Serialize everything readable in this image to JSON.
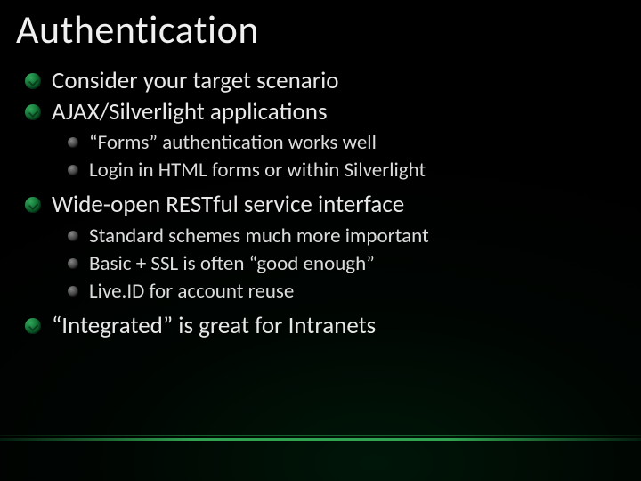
{
  "title": "Authentication",
  "bullets": {
    "l1_0": "Consider your target scenario",
    "l1_1": "AJAX/Silverlight applications",
    "l1_1_sub": {
      "s0": "“Forms” authentication works well",
      "s1": "Login in HTML forms or within Silverlight"
    },
    "l1_2": "Wide-open RESTful service interface",
    "l1_2_sub": {
      "s0": "Standard schemes much more important",
      "s1": "Basic + SSL is often “good enough”",
      "s2": "Live.ID for account reuse"
    },
    "l1_3": "“Integrated” is great for Intranets"
  }
}
